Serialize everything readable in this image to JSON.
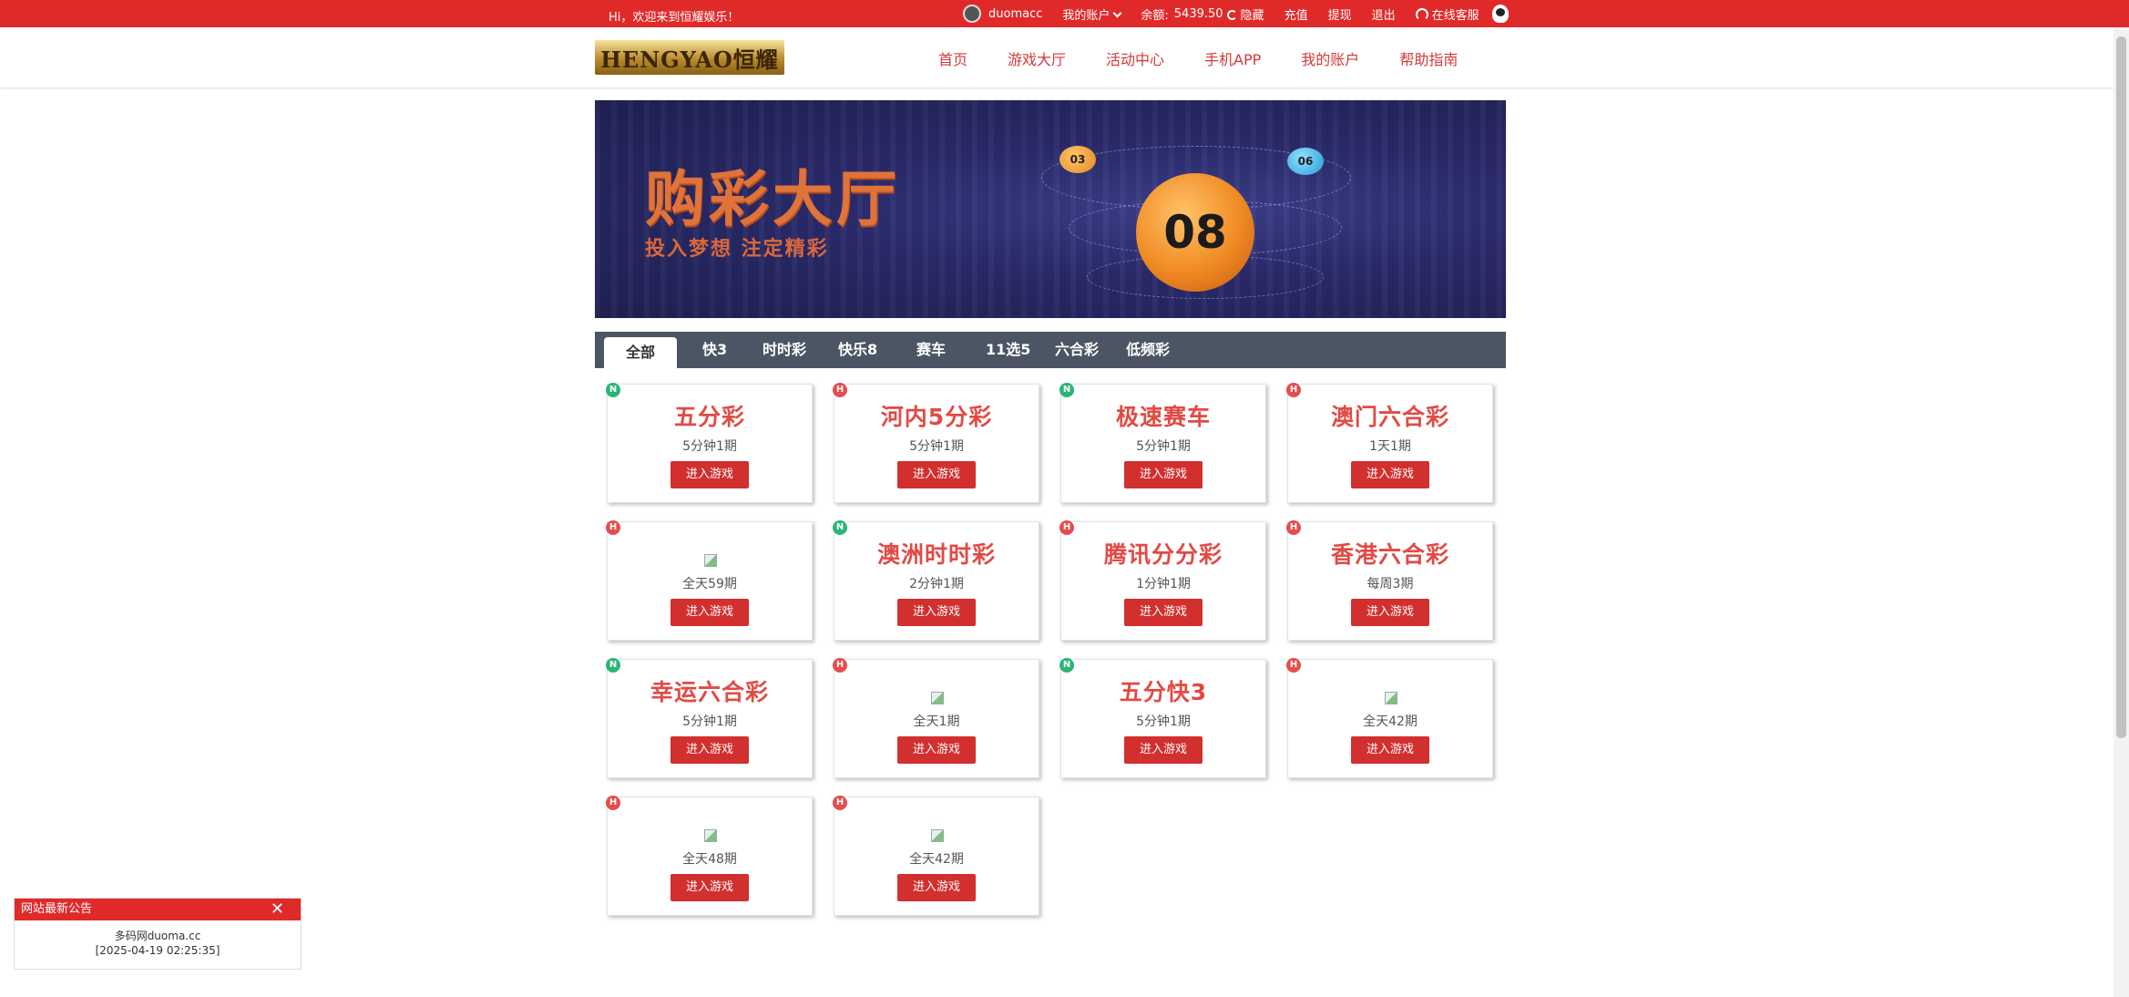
{
  "topbar": {
    "welcome": "Hi，欢迎来到恒耀娱乐！",
    "username": "duomacc",
    "my_account": "我的账户",
    "balance_label": "余额:",
    "balance_value": "5439.50",
    "hide": "隐藏",
    "recharge": "充值",
    "withdraw": "提现",
    "logout": "退出",
    "online_service": "在线客服"
  },
  "header": {
    "logo_text": "HENGYAO恒耀",
    "nav": [
      "首页",
      "游戏大厅",
      "活动中心",
      "手机APP",
      "我的账户",
      "帮助指南"
    ]
  },
  "banner": {
    "title": "购彩大厅",
    "subtitle": "投入梦想  注定精彩",
    "ball_main": "08",
    "ball_a": "03",
    "ball_b": "06"
  },
  "tabs": [
    "全部",
    "快3",
    "时时彩",
    "快乐8",
    "赛车",
    "11选5",
    "六合彩",
    "低频彩"
  ],
  "games": [
    {
      "badge": "N",
      "title": "五分彩",
      "period": "5分钟1期",
      "button": "进入游戏"
    },
    {
      "badge": "H",
      "title": "河内5分彩",
      "period": "5分钟1期",
      "button": "进入游戏"
    },
    {
      "badge": "N",
      "title": "极速赛车",
      "period": "5分钟1期",
      "button": "进入游戏"
    },
    {
      "badge": "H",
      "title": "澳门六合彩",
      "period": "1天1期",
      "button": "进入游戏"
    },
    {
      "badge": "H",
      "title": "",
      "period": "全天59期",
      "button": "进入游戏"
    },
    {
      "badge": "N",
      "title": "澳洲时时彩",
      "period": "2分钟1期",
      "button": "进入游戏"
    },
    {
      "badge": "H",
      "title": "腾讯分分彩",
      "period": "1分钟1期",
      "button": "进入游戏"
    },
    {
      "badge": "H",
      "title": "香港六合彩",
      "period": "每周3期",
      "button": "进入游戏"
    },
    {
      "badge": "N",
      "title": "幸运六合彩",
      "period": "5分钟1期",
      "button": "进入游戏"
    },
    {
      "badge": "H",
      "title": "",
      "period": "全天1期",
      "button": "进入游戏"
    },
    {
      "badge": "N",
      "title": "五分快3",
      "period": "5分钟1期",
      "button": "进入游戏"
    },
    {
      "badge": "H",
      "title": "",
      "period": "全天42期",
      "button": "进入游戏"
    },
    {
      "badge": "H",
      "title": "",
      "period": "全天48期",
      "button": "进入游戏"
    },
    {
      "badge": "H",
      "title": "",
      "period": "全天42期",
      "button": "进入游戏"
    }
  ],
  "notice": {
    "title": "网站最新公告",
    "close": "✕",
    "message": "多码网duoma.cc",
    "time": "[2025-04-19 02:25:35]"
  },
  "colors": {
    "brand_red": "#e02a2a",
    "tab_bar": "#4b5563",
    "badge_new": "#2bb673",
    "badge_hot": "#e74c4c"
  }
}
